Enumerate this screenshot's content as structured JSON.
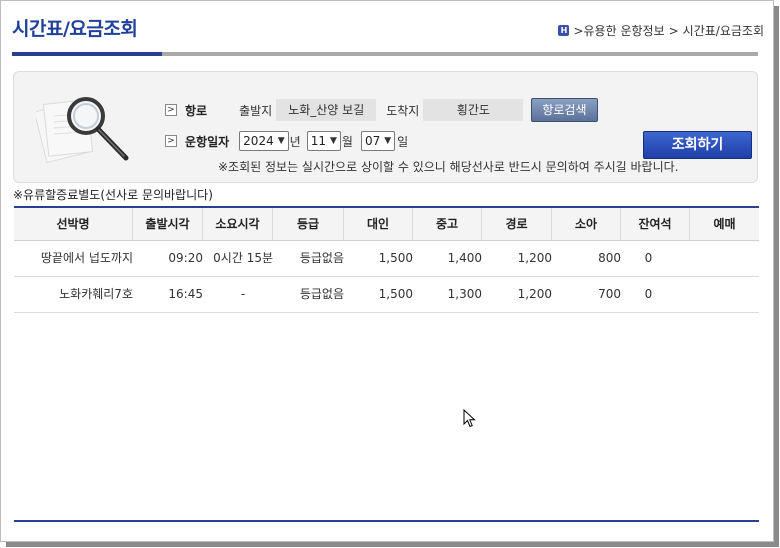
{
  "page": {
    "title": "시간표/요금조회",
    "breadcrumb": [
      ">유용한 운항정보",
      ">",
      "시간표/요금조회"
    ],
    "home_icon_letter": "H"
  },
  "search": {
    "route_label": "항로",
    "departure_label": "출발지",
    "departure_value": "노화_산양 보길",
    "arrival_label": "도착지",
    "arrival_value": "횡간도",
    "route_search_button": "항로검색",
    "date_label": "운항일자",
    "year": "2024",
    "year_unit": "년",
    "month": "11",
    "month_unit": "월",
    "day": "07",
    "day_unit": "일",
    "query_button": "조회하기",
    "notice": "※조회된 정보는 실시간으로 상이할 수 있으니 해당선사로 반드시 문의하여 주시길 바랍니다."
  },
  "surcharge_note": "※유류할증료별도(선사로 문의바랍니다)",
  "table": {
    "headers": [
      "선박명",
      "출발시각",
      "소요시각",
      "등급",
      "대인",
      "중고",
      "경로",
      "소아",
      "잔여석",
      "예매"
    ],
    "rows": [
      [
        "땅끝에서 넙도까지",
        "09:20",
        "0시간 15분",
        "등급없음",
        "1,500",
        "1,400",
        "1,200",
        "800",
        "0",
        ""
      ],
      [
        "노화카훼리7호",
        "16:45",
        "-",
        "등급없음",
        "1,500",
        "1,300",
        "1,200",
        "700",
        "0",
        ""
      ]
    ]
  },
  "colors": {
    "brand_blue": "#27418f",
    "title_blue": "#1f3f99",
    "query_button": "#2a4fbf"
  }
}
